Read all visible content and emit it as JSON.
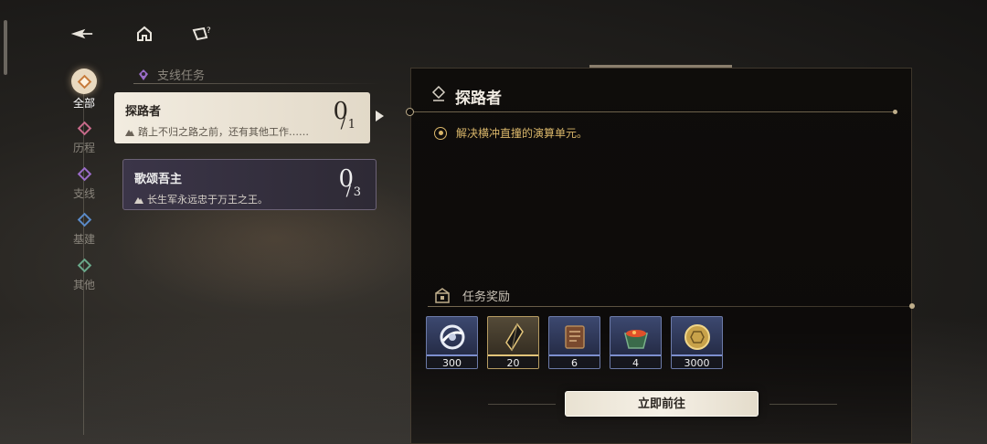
{
  "top_nav": {
    "icons": [
      "back-arrow-icon",
      "home-icon",
      "quest-hint-icon"
    ]
  },
  "categories": [
    {
      "label": "全部",
      "icon": "all-icon",
      "color": "#c67a3a",
      "active": true
    },
    {
      "label": "历程",
      "icon": "journey-icon",
      "color": "#c76a8a",
      "active": false
    },
    {
      "label": "支线",
      "icon": "side-quest-icon",
      "color": "#9a6cc8",
      "active": false
    },
    {
      "label": "基建",
      "icon": "base-icon",
      "color": "#5a8ac8",
      "active": false
    },
    {
      "label": "其他",
      "icon": "other-icon",
      "color": "#6aa88a",
      "active": false
    }
  ],
  "section": {
    "label": "支线任务",
    "icon": "side-quest-icon"
  },
  "quests": [
    {
      "title": "探路者",
      "subtitle": "踏上不归之路之前，还有其他工作……",
      "count": "0",
      "slash": "/",
      "total": "1",
      "selected": true
    },
    {
      "title": "歌颂吾主",
      "subtitle": "长生军永远忠于万王之王。",
      "count": "0",
      "slash": "/",
      "total": "3",
      "selected": false
    }
  ],
  "detail": {
    "title": "探路者",
    "objective": "解决横冲直撞的演算单元。",
    "rewards_label": "任务奖励",
    "rewards": [
      {
        "icon": "orb-ring-icon",
        "qty": "300",
        "rarity": "blue"
      },
      {
        "icon": "dark-crystal-icon",
        "qty": "20",
        "rarity": "gold"
      },
      {
        "icon": "leather-book-icon",
        "qty": "6",
        "rarity": "blue"
      },
      {
        "icon": "ember-box-icon",
        "qty": "4",
        "rarity": "blue"
      },
      {
        "icon": "gold-coin-icon",
        "qty": "3000",
        "rarity": "blue"
      }
    ],
    "go_button": "立即前往"
  },
  "colors": {
    "objective": "#d9b66a",
    "accent_gold": "#bfae8b",
    "card_active": "#f2ece0"
  }
}
